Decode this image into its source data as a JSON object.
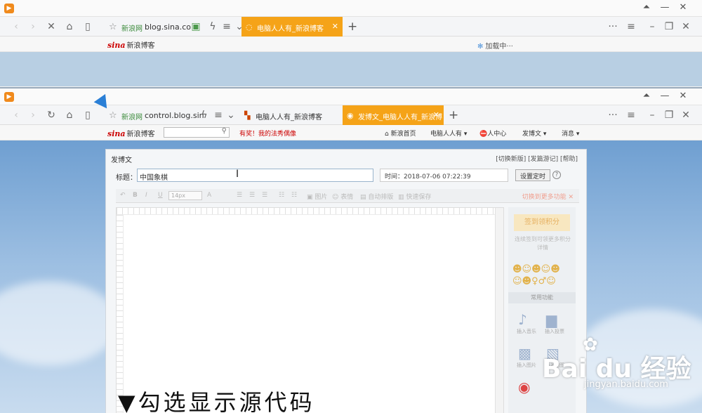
{
  "back_window": {
    "url_site": "新浪网",
    "url": "blog.sina.co",
    "tab_title": "电脑人人有_新浪博客",
    "sina_logo": "sina",
    "sina_text": "新浪博客",
    "loading_text": "加载中···"
  },
  "front_window": {
    "url_site": "新浪网",
    "url": "control.blog.sin",
    "tabs": [
      {
        "title": "电脑人人有_新浪博客",
        "active": false
      },
      {
        "title": "发博文_电脑人人有_新浪博",
        "active": true
      }
    ],
    "sina_logo": "sina",
    "sina_text": "新浪博客",
    "promo": "有奖！我的法秀偶像",
    "nav": [
      "新浪首页",
      "电脑人人有",
      "人中心",
      "发博文",
      "消息"
    ]
  },
  "editor": {
    "heading": "发博文",
    "links": "[切换新版] [发篇游记] [帮助]",
    "title_label": "标题：",
    "title_value": "中国象棋",
    "time_label": "时间：2018-07-06 07:22:39",
    "schedule_button": "设置定时",
    "help": "?",
    "font_size": "14px",
    "toolbar": [
      "B",
      "I",
      "U",
      "图片",
      "表情",
      "自动排版",
      "快速保存"
    ],
    "toolbar_link": "切换到更多功能",
    "sign_button": "签到领积分",
    "sidebar_note": "连续签到可领更多积分详情",
    "common_functions": "常用功能",
    "side_captions": [
      "插入音乐",
      "插入投票",
      "插入图片",
      "插入地图"
    ]
  },
  "overlay": {
    "caption": "▼勾选显示源代码",
    "watermark_brand": "Bai du 经验",
    "watermark_url": "jingyan.baidu.com"
  },
  "colors": {
    "active_tab": "#f5a318",
    "sina_red": "#cc0000",
    "sky_blue": "#6f9fd1"
  }
}
